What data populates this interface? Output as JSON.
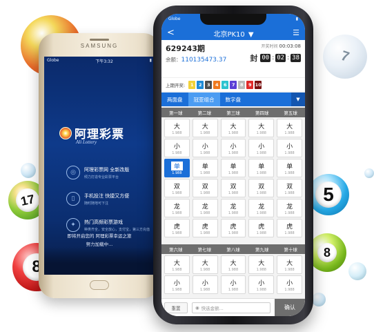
{
  "balls": {
    "ball_17": "17",
    "ball_8": "8",
    "ball_7": "7",
    "ball_5": "5",
    "ball_8_right": "8"
  },
  "samsung": {
    "brand": "SAMSUNG",
    "status": {
      "carrier": "Globe",
      "time": "下午3:32"
    },
    "logo": {
      "name": "阿理彩票",
      "sub": "Ali Lottery"
    },
    "features": [
      {
        "icon": "target-icon",
        "title": "阿理彩票网 全新改版",
        "desc": "倾力打造专业彩票平台"
      },
      {
        "icon": "phone-icon",
        "title": "手机投注 快捷又方便",
        "desc": "随时随地可下注"
      },
      {
        "icon": "game-icon",
        "title": "热门高频彩票游戏",
        "desc": "种类齐全，安全放心，支付宝，第三方充值"
      }
    ],
    "footer_line1": "即将开启您的 阿理彩票幸运之旅",
    "footer_line2": "努力加载中..."
  },
  "iphone": {
    "status": {
      "carrier": "Globe"
    },
    "header": {
      "back": "<",
      "title": "北京PK10",
      "title_caret": "▼",
      "menu": "☰"
    },
    "info": {
      "period": "629243期",
      "balance_label": "余额：",
      "balance": "110135473.37",
      "open_time_label": "开奖时间",
      "open_time": "00:03:08",
      "close_label": "封",
      "countdown": [
        "00",
        "02",
        "38"
      ]
    },
    "last_draw": {
      "label": "上期开奖:",
      "numbers": [
        "1",
        "2",
        "3",
        "4",
        "6",
        "7",
        "8",
        "9",
        "10"
      ],
      "colors": [
        "#f2d23a",
        "#1e8bd8",
        "#4d4d4d",
        "#f07a20",
        "#2cc3cf",
        "#5b3fd6",
        "#bbbbbb",
        "#e02a2a",
        "#7a0f0f"
      ]
    },
    "tabs": [
      "两面盘",
      "冠亚组合",
      "数字盘"
    ],
    "tab_arrow": "▼",
    "group1": {
      "columns": [
        "第一球",
        "第二球",
        "第三球",
        "第四球",
        "第五球"
      ],
      "rows": [
        [
          "大",
          "大",
          "大",
          "大",
          "大"
        ],
        [
          "小",
          "小",
          "小",
          "小",
          "小"
        ],
        [
          "单",
          "单",
          "单",
          "单",
          "单"
        ],
        [
          "双",
          "双",
          "双",
          "双",
          "双"
        ],
        [
          "龙",
          "龙",
          "龙",
          "龙",
          "龙"
        ],
        [
          "虎",
          "虎",
          "虎",
          "虎",
          "虎"
        ]
      ],
      "odds": "1.988"
    },
    "group2": {
      "columns": [
        "第六球",
        "第七球",
        "第八球",
        "第九球",
        "第十球"
      ],
      "rows": [
        [
          "大",
          "大",
          "大",
          "大",
          "大"
        ],
        [
          "小",
          "小",
          "小",
          "小",
          "小"
        ]
      ],
      "odds": "1.988"
    },
    "bottom": {
      "reset": "重置",
      "amount_placeholder": "快选金额...",
      "confirm": "确认"
    }
  }
}
